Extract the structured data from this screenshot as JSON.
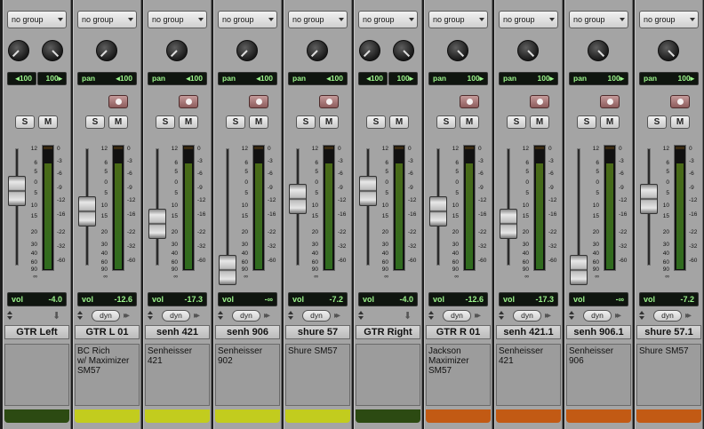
{
  "scale_ticks": [
    "12",
    "6",
    "5",
    "0",
    "5",
    "10",
    "15",
    "20",
    "30",
    "40",
    "60",
    "90",
    "∞"
  ],
  "meter_ticks": [
    "0",
    "-3",
    "-6",
    "-9",
    "-12",
    "-16",
    "-22",
    "-32",
    "-60"
  ],
  "colors": {
    "dark_green": "#2c4a12",
    "lime": "#c2cc1e",
    "orange": "#c25a14",
    "meter_green": "#2f6b1f",
    "display_text": "#9cf58c"
  },
  "strips": [
    {
      "group": "no group",
      "stereo": true,
      "pan_left": "◂100",
      "pan_right": "100▸",
      "show_rec": false,
      "solo": "S",
      "mute": "M",
      "fader_db": -4.0,
      "vol_label": "vol",
      "vol_value": "-4.0",
      "ctrl": "arrow",
      "dyn_label": "",
      "name": "GTR Left",
      "comment_lines": [],
      "color": "dark_green"
    },
    {
      "group": "no group",
      "stereo": false,
      "pan_label": "pan",
      "pan_value": "◂100",
      "show_rec": true,
      "solo": "S",
      "mute": "M",
      "fader_db": -12.6,
      "vol_label": "vol",
      "vol_value": "-12.6",
      "ctrl": "dyn",
      "dyn_label": "dyn",
      "name": "GTR L 01",
      "comment_lines": [
        "BC Rich",
        "w/ Maximizer",
        "SM57"
      ],
      "color": "lime"
    },
    {
      "group": "no group",
      "stereo": false,
      "pan_label": "pan",
      "pan_value": "◂100",
      "show_rec": true,
      "solo": "S",
      "mute": "M",
      "fader_db": -17.3,
      "vol_label": "vol",
      "vol_value": "-17.3",
      "ctrl": "dyn",
      "dyn_label": "dyn",
      "name": "senh 421",
      "comment_lines": [
        "Senheisser",
        "421"
      ],
      "color": "lime"
    },
    {
      "group": "no group",
      "stereo": false,
      "pan_label": "pan",
      "pan_value": "◂100",
      "show_rec": true,
      "solo": "S",
      "mute": "M",
      "fader_db": -100,
      "vol_label": "vol",
      "vol_value": "-∞",
      "ctrl": "dyn",
      "dyn_label": "dyn",
      "name": "senh 906",
      "comment_lines": [
        "Senheisser",
        "902"
      ],
      "color": "lime"
    },
    {
      "group": "no group",
      "stereo": false,
      "pan_label": "pan",
      "pan_value": "◂100",
      "show_rec": true,
      "solo": "S",
      "mute": "M",
      "fader_db": -7.2,
      "vol_label": "vol",
      "vol_value": "-7.2",
      "ctrl": "dyn",
      "dyn_label": "dyn",
      "name": "shure 57",
      "comment_lines": [
        "Shure SM57"
      ],
      "color": "lime"
    },
    {
      "group": "no group",
      "stereo": true,
      "pan_left": "◂100",
      "pan_right": "100▸",
      "show_rec": false,
      "solo": "S",
      "mute": "M",
      "fader_db": -4.0,
      "vol_label": "vol",
      "vol_value": "-4.0",
      "ctrl": "arrow",
      "dyn_label": "",
      "name": "GTR Right",
      "comment_lines": [],
      "color": "dark_green"
    },
    {
      "group": "no group",
      "stereo": false,
      "pan_label": "pan",
      "pan_value": "100▸",
      "show_rec": true,
      "solo": "S",
      "mute": "M",
      "fader_db": -12.6,
      "vol_label": "vol",
      "vol_value": "-12.6",
      "ctrl": "dyn",
      "dyn_label": "dyn",
      "name": "GTR R 01",
      "comment_lines": [
        "Jackson",
        "Maximizer",
        "SM57"
      ],
      "color": "orange"
    },
    {
      "group": "no group",
      "stereo": false,
      "pan_label": "pan",
      "pan_value": "100▸",
      "show_rec": true,
      "solo": "S",
      "mute": "M",
      "fader_db": -17.3,
      "vol_label": "vol",
      "vol_value": "-17.3",
      "ctrl": "dyn",
      "dyn_label": "dyn",
      "name": "senh 421.1",
      "comment_lines": [
        "Senheisser",
        "421"
      ],
      "color": "orange"
    },
    {
      "group": "no group",
      "stereo": false,
      "pan_label": "pan",
      "pan_value": "100▸",
      "show_rec": true,
      "solo": "S",
      "mute": "M",
      "fader_db": -100,
      "vol_label": "vol",
      "vol_value": "-∞",
      "ctrl": "dyn",
      "dyn_label": "dyn",
      "name": "senh 906.1",
      "comment_lines": [
        "Senheisser",
        "906"
      ],
      "color": "orange"
    },
    {
      "group": "no group",
      "stereo": false,
      "pan_label": "pan",
      "pan_value": "100▸",
      "show_rec": true,
      "solo": "S",
      "mute": "M",
      "fader_db": -7.2,
      "vol_label": "vol",
      "vol_value": "-7.2",
      "ctrl": "dyn",
      "dyn_label": "dyn",
      "name": "shure 57.1",
      "comment_lines": [
        "Shure SM57"
      ],
      "color": "orange"
    }
  ]
}
